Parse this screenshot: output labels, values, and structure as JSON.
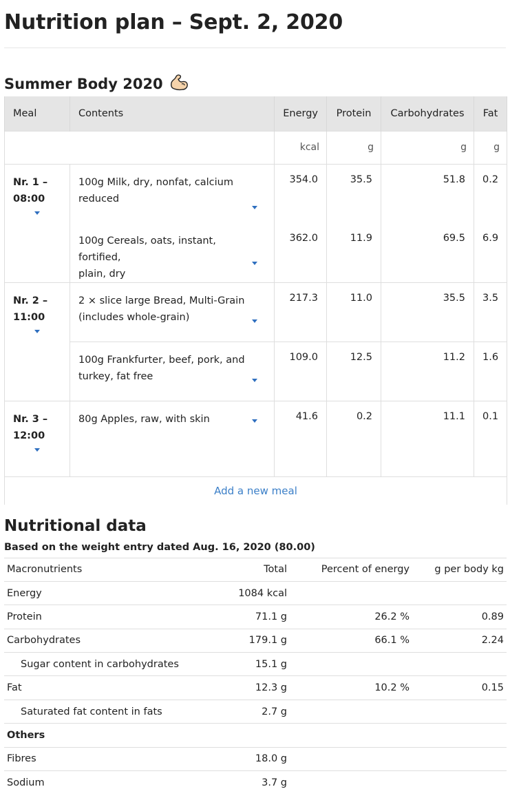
{
  "page": {
    "title": "Nutrition plan – Sept. 2, 2020",
    "plan_name": "Summer Body 2020"
  },
  "plan_table": {
    "headers": [
      "Meal",
      "Contents",
      "Energy",
      "Protein",
      "Carbohydrates",
      "Fat"
    ],
    "units": [
      "",
      "",
      "kcal",
      "g",
      "g",
      "g"
    ],
    "meals": [
      {
        "label_line1": "Nr. 1 –",
        "label_line2": "08:00",
        "items": [
          {
            "line1": "100g Milk, dry, nonfat, calcium",
            "line2": "reduced",
            "energy": "354.0",
            "protein": "35.5",
            "carbs": "51.8",
            "fat": "0.2"
          },
          {
            "line1": "100g Cereals, oats, instant, fortified,",
            "line2": "plain, dry",
            "energy": "362.0",
            "protein": "11.9",
            "carbs": "69.5",
            "fat": "6.9"
          }
        ]
      },
      {
        "label_line1": "Nr. 2 –",
        "label_line2": "11:00",
        "items": [
          {
            "line1": "2 × slice large Bread, Multi-Grain",
            "line2": "(includes whole-grain)",
            "energy": "217.3",
            "protein": "11.0",
            "carbs": "35.5",
            "fat": "3.5"
          },
          {
            "line1": "100g Frankfurter, beef, pork, and",
            "line2": "turkey, fat free",
            "energy": "109.0",
            "protein": "12.5",
            "carbs": "11.2",
            "fat": "1.6"
          }
        ]
      },
      {
        "label_line1": "Nr. 3 –",
        "label_line2": "12:00",
        "items": [
          {
            "line1": "80g Apples, raw, with skin",
            "line2": "",
            "energy": "41.6",
            "protein": "0.2",
            "carbs": "11.1",
            "fat": "0.1"
          }
        ]
      }
    ],
    "add_meal_label": "Add a new meal"
  },
  "nutritional_data": {
    "title": "Nutritional data",
    "weight_note": "Based on the weight entry dated Aug. 16, 2020 (80.00)",
    "headers": [
      "Macronutrients",
      "Total",
      "Percent of energy",
      "g per body kg"
    ],
    "rows": [
      {
        "name": "Energy",
        "total": "1084 kcal",
        "percent": "",
        "per_kg": ""
      },
      {
        "name": "Protein",
        "total": "71.1 g",
        "percent": "26.2 %",
        "per_kg": "0.89"
      },
      {
        "name": "Carbohydrates",
        "total": "179.1 g",
        "percent": "66.1 %",
        "per_kg": "2.24"
      },
      {
        "name": "Sugar content in carbohydrates",
        "total": "15.1 g",
        "percent": "",
        "per_kg": ""
      },
      {
        "name": "Fat",
        "total": "12.3 g",
        "percent": "10.2 %",
        "per_kg": "0.15"
      },
      {
        "name": "Saturated fat content in fats",
        "total": "2.7 g",
        "percent": "",
        "per_kg": ""
      },
      {
        "name": "Others",
        "total": "",
        "percent": "",
        "per_kg": ""
      },
      {
        "name": "Fibres",
        "total": "18.0 g",
        "percent": "",
        "per_kg": ""
      },
      {
        "name": "Sodium",
        "total": "3.7 g",
        "percent": "",
        "per_kg": ""
      }
    ]
  },
  "colors": {
    "link": "#3b7fc8",
    "caret": "#2f6fbf",
    "header_bg": "#e5e5e5",
    "emoji_skin": "#f5d3ab"
  },
  "icons": {
    "plan_emoji": "flexed-biceps-icon",
    "dropdown": "caret-down-icon"
  }
}
